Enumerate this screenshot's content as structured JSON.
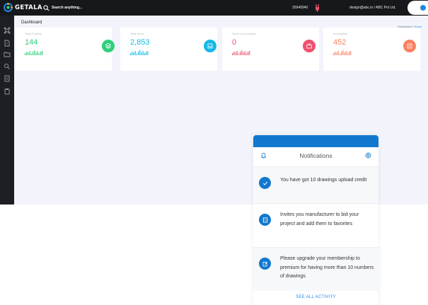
{
  "topbar": {
    "brand": "GETALA",
    "search_placeholder": "Search anything...",
    "phone": "25940940",
    "account": "design@abc.in / ABC Pvt Ltd.",
    "icons": {
      "logo": "getala-logo-icon",
      "search": "search-icon",
      "plug": "plug-icon",
      "toggle": "toggle-switch"
    }
  },
  "sidebar": {
    "icons": [
      "command-icon",
      "file-icon",
      "folder-icon",
      "search-icon",
      "document-icon",
      "clipboard-icon"
    ]
  },
  "main": {
    "title": "Dashboard",
    "breadcrumb": {
      "root": "Dashboard",
      "sep": " / ",
      "current": "Home"
    }
  },
  "cards": [
    {
      "label": "Total Projects",
      "value": "144",
      "color": "#2fd07b",
      "icon": "layers-icon"
    },
    {
      "label": "Total Items",
      "value": "2,853",
      "color": "#13b9e6",
      "icon": "inbox-icon"
    },
    {
      "label": "Order to be placed",
      "value": "0",
      "color": "#f0506e",
      "icon": "briefcase-icon"
    },
    {
      "label": "In progress",
      "value": "452",
      "color": "#fb8062",
      "icon": "list-icon"
    }
  ],
  "notifications": {
    "title": "Notifications",
    "items": [
      {
        "text": "You have got 10 drawings upload credit",
        "icon": "check-icon"
      },
      {
        "text": "Invites you manufacturer to bid your project and add them to favorites",
        "icon": "document-icon"
      },
      {
        "text": "Please upgrade your membership to premium for having more than 10 numbers of drawings",
        "icon": "edit-icon"
      }
    ],
    "footer": "SEE ALL ACTIVITY",
    "icons": {
      "bell": "bell-icon",
      "settings": "gear-icon"
    },
    "accent": "#1278cf"
  }
}
